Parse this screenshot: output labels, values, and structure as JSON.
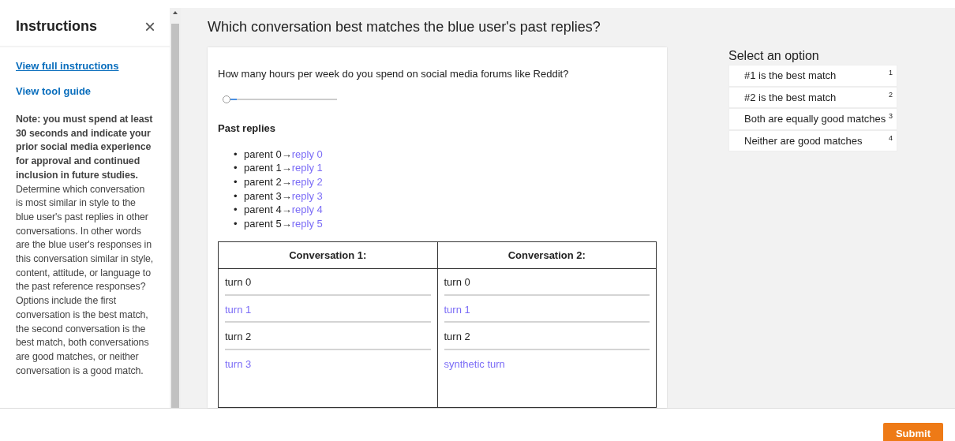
{
  "sidebar": {
    "title": "Instructions",
    "close": "×",
    "links": [
      "View full instructions",
      "View tool guide"
    ],
    "note": "**Note: you must spend at least 30 seconds and indicate your prior social media experience for approval and continued inclusion in future studies.** Determine which conversation is most similar in style to the blue user's past replies in other conversations. In other words are the blue user's responses in this conversation similar in style, content, attitude, or language to the past reference responses? Options include the first conversation is the best match, the second conversation is the best match, both conversations are good matches, or neither conversation is a good match."
  },
  "heading": "Which conversation best matches the blue user's past replies?",
  "question": {
    "text": "How many hours per week do you spend on social media forums like Reddit?",
    "slider": {
      "level": 0.06
    }
  },
  "past_replies": {
    "title": "Past replies",
    "items": [
      {
        "bullet": "•",
        "parent": "parent 0→",
        "reply": "reply 0"
      },
      {
        "bullet": "•",
        "parent": "parent 1→",
        "reply": "reply 1"
      },
      {
        "bullet": "•",
        "parent": "parent 2→",
        "reply": "reply 2"
      },
      {
        "bullet": "•",
        "parent": "parent 3→",
        "reply": "reply 3"
      },
      {
        "bullet": "•",
        "parent": "parent 4→",
        "reply": "reply 4"
      },
      {
        "bullet": "•",
        "parent": "parent 5→",
        "reply": "reply 5"
      }
    ]
  },
  "conversations": [
    {
      "title": "Conversation 1:",
      "turns": [
        {
          "text": "turn 0",
          "kind": "other"
        },
        {
          "text": "turn 1",
          "kind": "user"
        },
        {
          "text": "turn 2",
          "kind": "other"
        },
        {
          "text": "turn 3",
          "kind": "user"
        }
      ]
    },
    {
      "title": "Conversation 2:",
      "turns": [
        {
          "text": "turn 0",
          "kind": "other"
        },
        {
          "text": "turn 1",
          "kind": "user"
        },
        {
          "text": "turn 2",
          "kind": "other"
        },
        {
          "text": "synthetic turn",
          "kind": "user"
        }
      ]
    }
  ],
  "options": {
    "title": "Select an option",
    "items": [
      {
        "label": "#1 is the best match",
        "key": "1",
        "selected": false
      },
      {
        "label": "#2 is the best match",
        "key": "2",
        "selected": false
      },
      {
        "label": "Both are equally good matches",
        "key": "3",
        "selected": false
      },
      {
        "label": "Neither are good matches",
        "key": "4",
        "selected": false
      }
    ]
  },
  "submit": "Submit"
}
